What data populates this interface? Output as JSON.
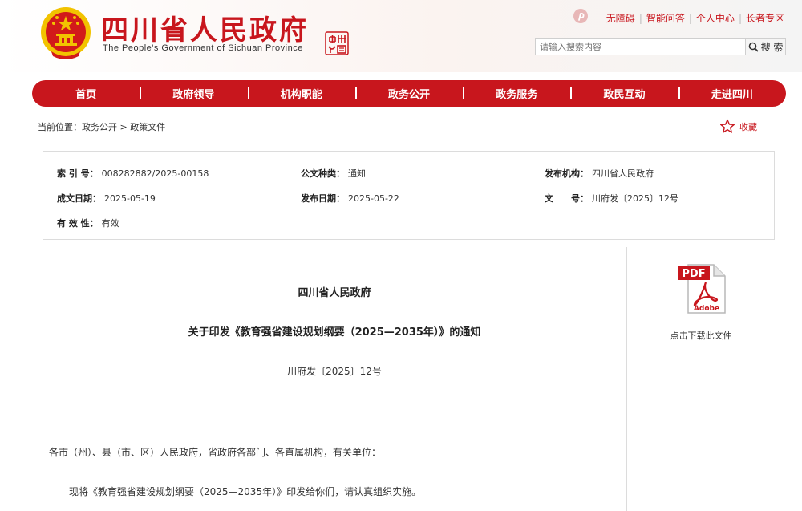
{
  "site": {
    "title": "四川省人民政府",
    "subtitle": "The People's Government of Sichuan Province"
  },
  "top_links": [
    "无障碍",
    "智能问答",
    "个人中心",
    "长者专区"
  ],
  "search": {
    "placeholder": "请输入搜索内容",
    "button_label": "搜 索"
  },
  "nav": [
    "首页",
    "政府领导",
    "机构职能",
    "政务公开",
    "政务服务",
    "政民互动",
    "走进四川"
  ],
  "breadcrumb": "当前位置：政务公开 > 政策文件",
  "favorite_label": "收藏",
  "meta": {
    "index_label": "索 引 号：",
    "index_value": "008282882/2025-00158",
    "type_label": "公文种类：",
    "type_value": "通知",
    "publisher_label": "发布机构：",
    "publisher_value": "四川省人民政府",
    "created_label": "成文日期：",
    "created_value": "2025-05-19",
    "published_label": "发布日期：",
    "published_value": "2025-05-22",
    "docno_label": "文　　号：",
    "docno_value": "川府发〔2025〕12号",
    "validity_label": "有 效 性：",
    "validity_value": "有效"
  },
  "article": {
    "org": "四川省人民政府",
    "title": "关于印发《教育强省建设规划纲要（2025—2035年）》的通知",
    "doc_no": "川府发〔2025〕12号",
    "salutation": "各市（州）、县（市、区）人民政府，省政府各部门、各直属机构，有关单位：",
    "paragraph1": "现将《教育强省建设规划纲要（2025—2035年）》印发给你们，请认真组织实施。"
  },
  "download": {
    "pdf_badge": "PDF",
    "adobe_label": "Adobe",
    "label": "点击下载此文件"
  },
  "colors": {
    "brand_red": "#c8161d"
  }
}
